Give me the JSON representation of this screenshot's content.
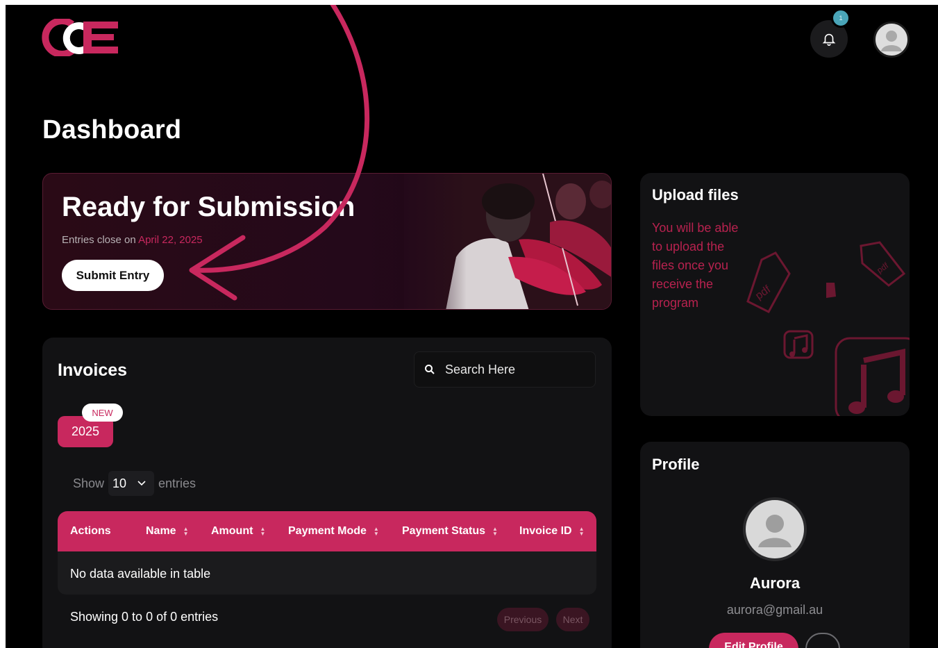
{
  "header": {
    "logo_text": "GCE",
    "notification_count": "1"
  },
  "page": {
    "title": "Dashboard"
  },
  "banner": {
    "title": "Ready for Submission",
    "subtitle_prefix": "Entries close on",
    "close_date": "April 22, 2025",
    "submit_label": "Submit Entry"
  },
  "invoices": {
    "title": "Invoices",
    "search_placeholder": "Search Here",
    "year": "2025",
    "new_badge": "NEW",
    "show_label": "Show",
    "page_size": "10",
    "entries_label": "entries",
    "columns": [
      "Actions",
      "Name",
      "Amount",
      "Payment Mode",
      "Payment Status",
      "Invoice ID"
    ],
    "empty_message": "No data available in table",
    "showing": "Showing 0 to 0 of 0 entries",
    "previous_label": "Previous",
    "next_label": "Next"
  },
  "upload": {
    "title": "Upload files",
    "message": "You will be able to upload the files once you receive the program"
  },
  "profile": {
    "title": "Profile",
    "name": "Aurora",
    "email": "aurora@gmail.au",
    "edit_label": "Edit Profile"
  },
  "colors": {
    "accent": "#c8285e",
    "background": "#000000",
    "card": "#121214"
  }
}
